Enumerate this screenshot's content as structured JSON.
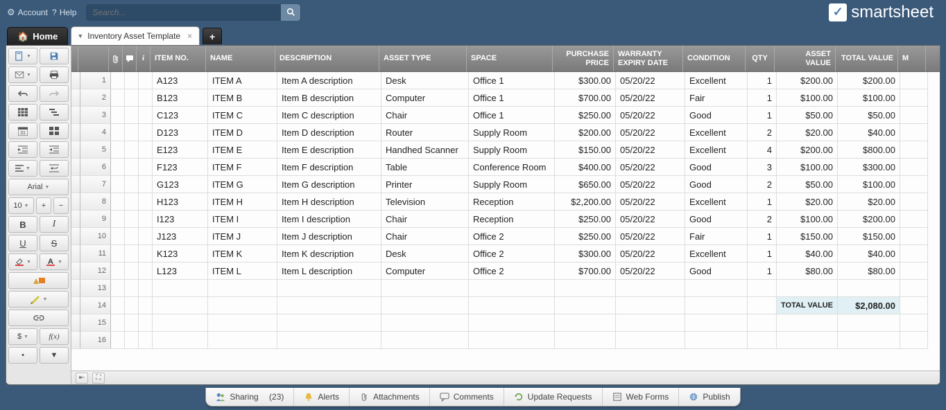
{
  "top": {
    "account": "Account",
    "help": "Help",
    "search_placeholder": "Search..."
  },
  "logo": "smartsheet",
  "tabs": {
    "home": "Home",
    "open": "Inventory Asset Template"
  },
  "toolbar": {
    "font": "Arial",
    "size": "10",
    "bold": "B",
    "italic": "I",
    "underline": "U",
    "strike": "S",
    "currency": "$",
    "fx": "f(x)"
  },
  "columns": {
    "item_no": "ITEM NO.",
    "name": "NAME",
    "description": "DESCRIPTION",
    "asset_type": "ASSET TYPE",
    "space": "SPACE",
    "purchase_price": "PURCHASE PRICE",
    "warranty": "WARRANTY EXPIRY DATE",
    "condition": "CONDITION",
    "qty": "QTY",
    "asset_value": "ASSET VALUE",
    "total_value": "TOTAL VALUE",
    "last": "M"
  },
  "rows": [
    {
      "n": "1",
      "item": "A123",
      "name": "ITEM A",
      "desc": "Item A description",
      "type": "Desk",
      "space": "Office 1",
      "price": "$300.00",
      "warr": "05/20/22",
      "cond": "Excellent",
      "qty": "1",
      "assetv": "$200.00",
      "totalv": "$200.00"
    },
    {
      "n": "2",
      "item": "B123",
      "name": "ITEM B",
      "desc": "Item B description",
      "type": "Computer",
      "space": "Office 1",
      "price": "$700.00",
      "warr": "05/20/22",
      "cond": "Fair",
      "qty": "1",
      "assetv": "$100.00",
      "totalv": "$100.00"
    },
    {
      "n": "3",
      "item": "C123",
      "name": "ITEM C",
      "desc": "Item C description",
      "type": "Chair",
      "space": "Office 1",
      "price": "$250.00",
      "warr": "05/20/22",
      "cond": "Good",
      "qty": "1",
      "assetv": "$50.00",
      "totalv": "$50.00"
    },
    {
      "n": "4",
      "item": "D123",
      "name": "ITEM D",
      "desc": "Item D description",
      "type": "Router",
      "space": "Supply Room",
      "price": "$200.00",
      "warr": "05/20/22",
      "cond": "Excellent",
      "qty": "2",
      "assetv": "$20.00",
      "totalv": "$40.00"
    },
    {
      "n": "5",
      "item": "E123",
      "name": "ITEM E",
      "desc": "Item E description",
      "type": "Handhed Scanner",
      "space": "Supply Room",
      "price": "$150.00",
      "warr": "05/20/22",
      "cond": "Excellent",
      "qty": "4",
      "assetv": "$200.00",
      "totalv": "$800.00"
    },
    {
      "n": "6",
      "item": "F123",
      "name": "ITEM F",
      "desc": "Item F description",
      "type": "Table",
      "space": "Conference Room",
      "price": "$400.00",
      "warr": "05/20/22",
      "cond": "Good",
      "qty": "3",
      "assetv": "$100.00",
      "totalv": "$300.00"
    },
    {
      "n": "7",
      "item": "G123",
      "name": "ITEM G",
      "desc": "Item G description",
      "type": "Printer",
      "space": "Supply Room",
      "price": "$650.00",
      "warr": "05/20/22",
      "cond": "Good",
      "qty": "2",
      "assetv": "$50.00",
      "totalv": "$100.00"
    },
    {
      "n": "8",
      "item": "H123",
      "name": "ITEM H",
      "desc": "Item H description",
      "type": "Television",
      "space": "Reception",
      "price": "$2,200.00",
      "warr": "05/20/22",
      "cond": "Excellent",
      "qty": "1",
      "assetv": "$20.00",
      "totalv": "$20.00"
    },
    {
      "n": "9",
      "item": "I123",
      "name": "ITEM I",
      "desc": "Item I description",
      "type": "Chair",
      "space": "Reception",
      "price": "$250.00",
      "warr": "05/20/22",
      "cond": "Good",
      "qty": "2",
      "assetv": "$100.00",
      "totalv": "$200.00"
    },
    {
      "n": "10",
      "item": "J123",
      "name": "ITEM J",
      "desc": "Item J description",
      "type": "Chair",
      "space": "Office 2",
      "price": "$250.00",
      "warr": "05/20/22",
      "cond": "Fair",
      "qty": "1",
      "assetv": "$150.00",
      "totalv": "$150.00"
    },
    {
      "n": "11",
      "item": "K123",
      "name": "ITEM K",
      "desc": "Item K description",
      "type": "Desk",
      "space": "Office 2",
      "price": "$300.00",
      "warr": "05/20/22",
      "cond": "Excellent",
      "qty": "1",
      "assetv": "$40.00",
      "totalv": "$40.00"
    },
    {
      "n": "12",
      "item": "L123",
      "name": "ITEM L",
      "desc": "Item L description",
      "type": "Computer",
      "space": "Office 2",
      "price": "$700.00",
      "warr": "05/20/22",
      "cond": "Good",
      "qty": "1",
      "assetv": "$80.00",
      "totalv": "$80.00"
    }
  ],
  "blank_rows": [
    "13",
    "14",
    "15",
    "16"
  ],
  "summary": {
    "label": "TOTAL VALUE",
    "value": "$2,080.00"
  },
  "bottom": {
    "sharing": "Sharing",
    "sharing_count": "(23)",
    "alerts": "Alerts",
    "attachments": "Attachments",
    "comments": "Comments",
    "update_requests": "Update Requests",
    "web_forms": "Web Forms",
    "publish": "Publish"
  }
}
